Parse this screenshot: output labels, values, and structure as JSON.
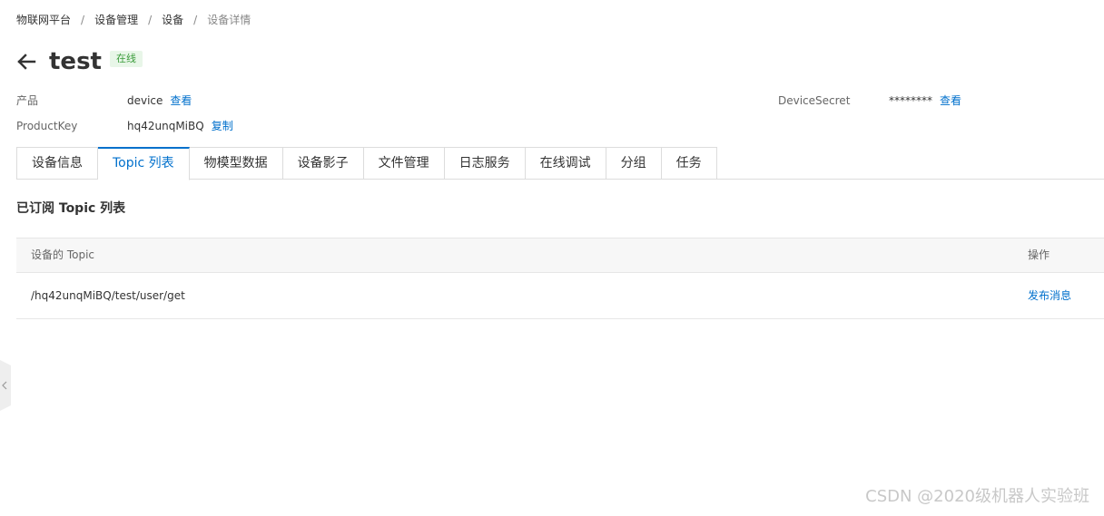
{
  "breadcrumb": {
    "items": [
      "物联网平台",
      "设备管理",
      "设备",
      "设备详情"
    ],
    "separator": "/"
  },
  "header": {
    "title": "test",
    "status": "在线",
    "back_icon": "arrow-left-icon"
  },
  "info": {
    "product_label": "产品",
    "product_value": "device",
    "product_link": "查看",
    "productkey_label": "ProductKey",
    "productkey_value": "hq42unqMiBQ",
    "productkey_link": "复制",
    "secret_label": "DeviceSecret",
    "secret_value": "********",
    "secret_link": "查看"
  },
  "tabs": [
    {
      "label": "设备信息",
      "active": false
    },
    {
      "label": "Topic 列表",
      "active": true
    },
    {
      "label": "物模型数据",
      "active": false
    },
    {
      "label": "设备影子",
      "active": false
    },
    {
      "label": "文件管理",
      "active": false
    },
    {
      "label": "日志服务",
      "active": false
    },
    {
      "label": "在线调试",
      "active": false
    },
    {
      "label": "分组",
      "active": false
    },
    {
      "label": "任务",
      "active": false
    }
  ],
  "section": {
    "title": "已订阅 Topic 列表"
  },
  "table": {
    "columns": [
      "设备的 Topic",
      "操作"
    ],
    "rows": [
      {
        "topic": "/hq42unqMiBQ/test/user/get",
        "action": "发布消息"
      }
    ]
  },
  "sidebar": {
    "collapse_icon": "chevron-left-icon"
  },
  "watermark": "CSDN @2020级机器人实验班",
  "colors": {
    "accent": "#0070cc",
    "status_bg": "#e8f6e8",
    "status_text": "#3c9c3c"
  }
}
